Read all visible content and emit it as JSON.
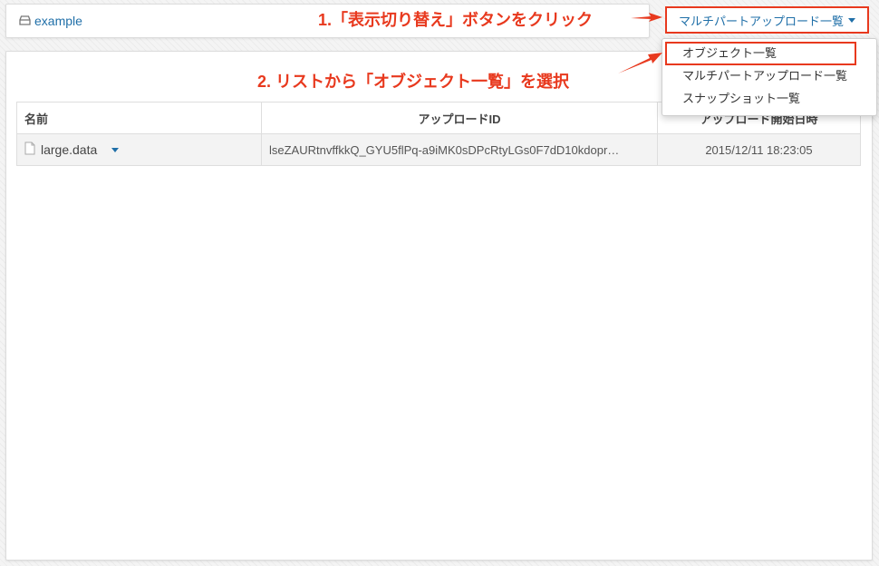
{
  "breadcrumb": {
    "bucket": "example",
    "bucket_icon": "bucket-icon"
  },
  "view_toggle": {
    "label": "マルチパートアップロード一覧"
  },
  "dropdown": {
    "items": [
      {
        "label": "オブジェクト一覧"
      },
      {
        "label": "マルチパートアップロード一覧"
      },
      {
        "label": "スナップショット一覧"
      }
    ]
  },
  "annotations": {
    "step1": "1.「表示切り替え」ボタンをクリック",
    "step2": "2. リストから「オブジェクト一覧」を選択",
    "color": "#e8391e"
  },
  "table": {
    "headers": {
      "name": "名前",
      "upload_id": "アップロードID",
      "started": "アップロード開始日時"
    },
    "rows": [
      {
        "name": "large.data",
        "upload_id": "lseZAURtnvffkkQ_GYU5flPq-a9iMK0sDPcRtyLGs0F7dD10kdopr…",
        "started": "2015/12/11 18:23:05"
      }
    ]
  },
  "colors": {
    "link": "#1f6fa8",
    "annotation": "#e8391e"
  }
}
